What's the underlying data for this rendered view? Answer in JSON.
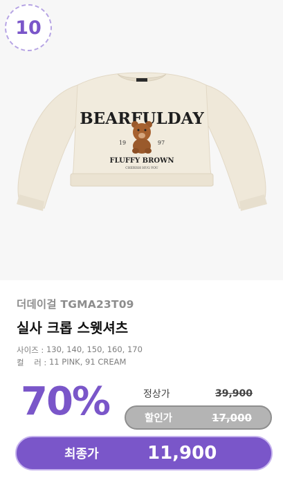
{
  "rank": "10",
  "product": {
    "brand_line": "더데이걸 TGMA23T09",
    "name": "실사 크롭 스웻셔츠",
    "image_print": {
      "headline": "BEARFULDAY",
      "year_left": "19",
      "year_right": "97",
      "subline": "FLUFFY BROWN",
      "tagline": "CHERISH HUG YOU"
    }
  },
  "specs": [
    {
      "label": "사이즈 : ",
      "value": "130, 140, 150, 160, 170"
    },
    {
      "label": "컬    러 : ",
      "value": "11 PINK, 91 CREAM"
    }
  ],
  "pricing": {
    "discount_rate": "70%",
    "regular_label": "정상가",
    "regular_price": "39,900",
    "sale_label": "할인가",
    "sale_price": "17,000",
    "final_label": "최종가",
    "final_price": "11,900"
  },
  "colors": {
    "accent": "#7a56c9",
    "accent_border": "#c6b3ee",
    "sale_pill": "#b4b4b4",
    "photo_background": "#f7f7f7",
    "sweatshirt": "#f1ebdd"
  }
}
